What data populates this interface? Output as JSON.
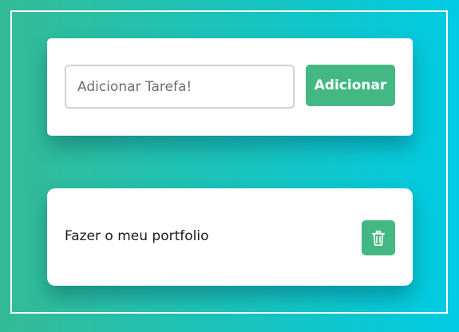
{
  "theme": {
    "gradient_start": "#34bb94",
    "gradient_end": "#00cbe3",
    "accent": "#43b883",
    "card_background": "#ffffff"
  },
  "add_form": {
    "input_placeholder": "Adicionar Tarefa!",
    "input_value": "",
    "add_button_label": "Adicionar"
  },
  "tasks": [
    {
      "text": "Fazer o meu portfolio",
      "action_icon": "trash-icon"
    }
  ]
}
